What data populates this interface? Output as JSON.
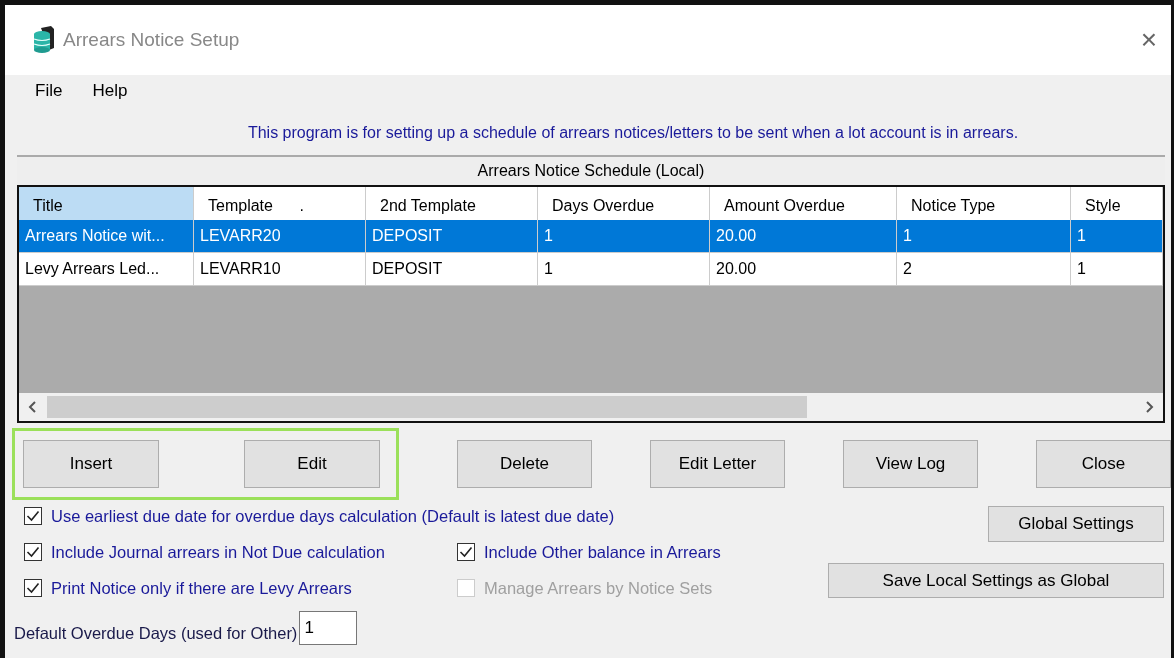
{
  "window": {
    "title": "Arrears Notice Setup",
    "close": "×"
  },
  "menu": [
    {
      "label": "File"
    },
    {
      "label": "Help"
    }
  ],
  "info": "This program is for setting up a schedule of arrears notices/letters to be sent when a lot account is in arrears.",
  "schedule": {
    "title": "Arrears Notice Schedule (Local)",
    "columns": [
      {
        "label": "Title",
        "selected": true
      },
      {
        "label": "Template      .",
        "selected": false
      },
      {
        "label": "2nd Template",
        "selected": false
      },
      {
        "label": "Days Overdue",
        "selected": false
      },
      {
        "label": "Amount Overdue",
        "selected": false
      },
      {
        "label": "Notice Type",
        "selected": false
      },
      {
        "label": "Style",
        "selected": false
      }
    ],
    "rows": [
      {
        "selected": true,
        "cells": [
          "Arrears Notice wit...",
          "LEVARR20",
          "DEPOSIT",
          "1",
          "20.00",
          "1",
          "1"
        ]
      },
      {
        "selected": false,
        "cells": [
          "Levy Arrears Led...",
          "LEVARR10",
          "DEPOSIT",
          "1",
          "20.00",
          "2",
          "1"
        ]
      }
    ]
  },
  "buttons": [
    {
      "label": "Insert",
      "highlighted": true
    },
    {
      "label": "Edit",
      "highlighted": true
    },
    {
      "label": "Delete",
      "highlighted": false
    },
    {
      "label": "Edit Letter",
      "highlighted": false
    },
    {
      "label": "View Log",
      "highlighted": false
    },
    {
      "label": "Close",
      "highlighted": false
    }
  ],
  "option_rows": [
    [
      {
        "label": "Use earliest due date for overdue days calculation (Default is latest due date)",
        "checked": true,
        "disabled": false
      }
    ],
    [
      {
        "label": "Include Journal arrears in Not Due calculation",
        "checked": true,
        "disabled": false
      },
      {
        "label": "Include Other balance in Arrears",
        "checked": true,
        "disabled": false
      }
    ],
    [
      {
        "label": "Print Notice only if there are Levy Arrears",
        "checked": true,
        "disabled": false
      },
      {
        "label": "Manage Arrears by Notice Sets",
        "checked": false,
        "disabled": true
      }
    ]
  ],
  "settings_buttons": [
    {
      "label": "Global Settings"
    },
    {
      "label": "Save Local Settings as Global"
    }
  ],
  "overdue_days": {
    "label": "Default Overdue Days (used for Other)",
    "value": "1"
  }
}
